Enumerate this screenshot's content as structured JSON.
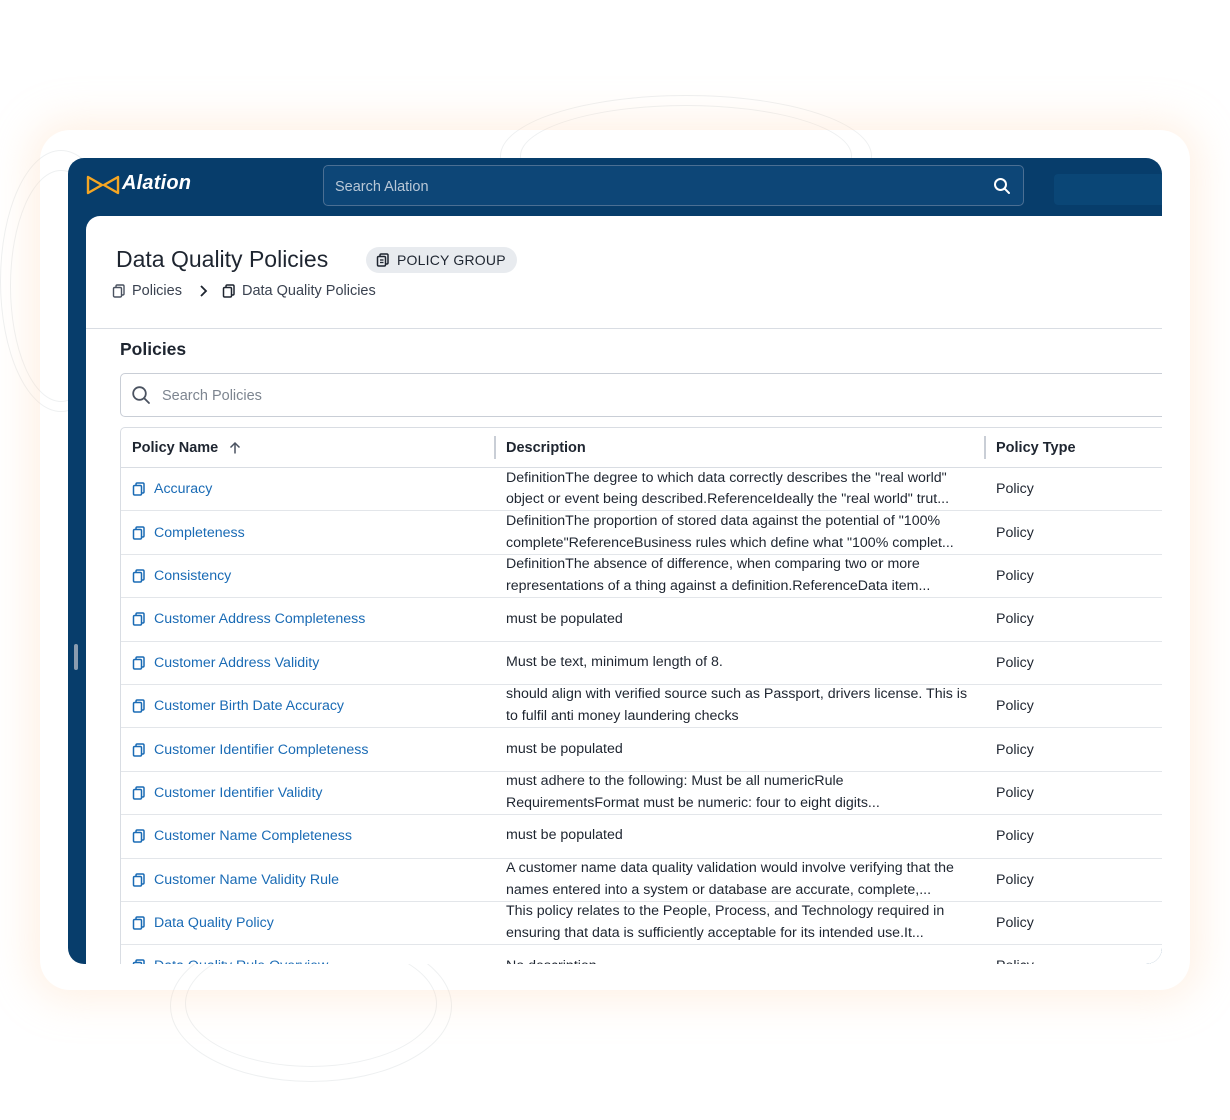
{
  "app": {
    "name": "Alation"
  },
  "topbar": {
    "search_placeholder": "Search Alation"
  },
  "page": {
    "title": "Data Quality Policies",
    "type_badge": "POLICY GROUP",
    "breadcrumb": [
      "Policies",
      "Data Quality Policies"
    ]
  },
  "policies_section": {
    "title": "Policies",
    "search_placeholder": "Search Policies"
  },
  "table": {
    "columns": [
      "Policy Name",
      "Description",
      "Policy Type"
    ],
    "sort_column": "Policy Name",
    "sort_direction": "ascending",
    "rows": [
      {
        "name": "Accuracy",
        "description": "DefinitionThe degree to which data correctly describes the \"real world\" object or event being described.ReferenceIdeally the \"real world\" trut...",
        "type": "Policy"
      },
      {
        "name": "Completeness",
        "description": "DefinitionThe proportion of stored data against the potential of \"100% complete\"ReferenceBusiness rules which define what \"100% complet...",
        "type": "Policy"
      },
      {
        "name": "Consistency",
        "description": "DefinitionThe absence of difference, when comparing two or more representations of a thing against a definition.ReferenceData item...",
        "type": "Policy"
      },
      {
        "name": "Customer Address Completeness",
        "description": "must be populated",
        "type": "Policy"
      },
      {
        "name": "Customer Address Validity",
        "description": "Must be text, minimum length of 8.",
        "type": "Policy"
      },
      {
        "name": "Customer Birth Date Accuracy",
        "description": "should align with verified source such as Passport, drivers license. This is to fulfil anti money laundering checks",
        "type": "Policy"
      },
      {
        "name": "Customer Identifier Completeness",
        "description": "must be populated",
        "type": "Policy"
      },
      {
        "name": "Customer Identifier Validity",
        "description": "must adhere to the following: Must be all numericRule RequirementsFormat must be numeric: four to eight digits...",
        "type": "Policy"
      },
      {
        "name": "Customer Name Completeness",
        "description": "must be populated",
        "type": "Policy"
      },
      {
        "name": "Customer Name Validity Rule",
        "description": "A customer name data quality validation would involve verifying that the names entered into a system or database are accurate, complete,...",
        "type": "Policy"
      },
      {
        "name": "Data Quality Policy",
        "description": "This policy relates to the People, Process, and Technology required in ensuring that data is sufficiently acceptable for its intended use.It...",
        "type": "Policy"
      },
      {
        "name": "Data Quality Rule Overview",
        "description": "No description",
        "type": "Policy"
      }
    ]
  },
  "colors": {
    "nav_background": "#073d6b",
    "link": "#1a6bb5",
    "logo_accent": "#f5a623"
  },
  "icons": {
    "search": "search-icon",
    "policy": "policy-icon",
    "sort": "arrow-up-icon",
    "breadcrumb_separator": "chevron-right-icon"
  }
}
